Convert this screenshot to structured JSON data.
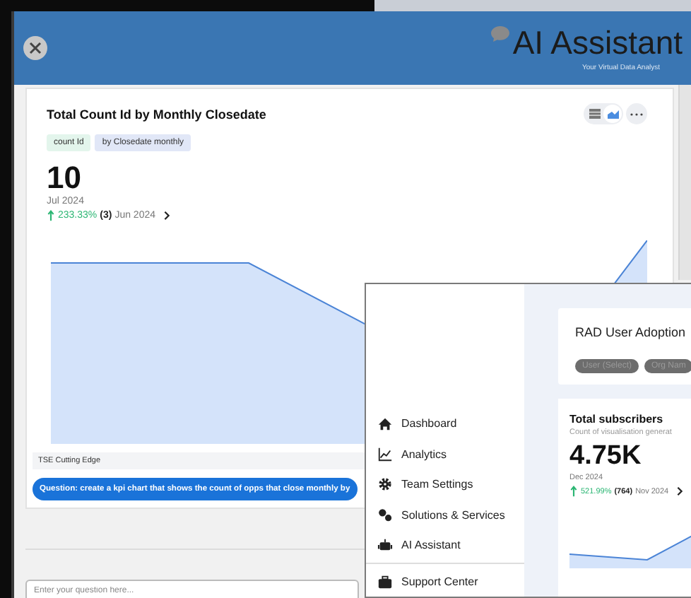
{
  "assistant_window": {
    "title": "AI Assistant",
    "subtitle": "Your Virtual Data Analyst",
    "card": {
      "title": "Total Count Id by Monthly Closedate",
      "view_toggle": [
        {
          "kind": "table",
          "selected": false
        },
        {
          "kind": "chart",
          "selected": true
        }
      ],
      "chips": [
        {
          "label": "count Id",
          "kind": "measure"
        },
        {
          "label": "by Closedate monthly",
          "kind": "dimension"
        }
      ],
      "value": "10",
      "period": "Jul 2024",
      "change": {
        "percent": "233.33%",
        "delta": "(3)",
        "previous": "Jun 2024"
      },
      "source": "TSE Cutting Edge",
      "question": "Question: create a kpi chart that shows the count of opps that close monthly by"
    },
    "input": {
      "placeholder": "Enter your question here..."
    }
  },
  "dashboard_window": {
    "nav": [
      {
        "label": "Dashboard",
        "kind": "home"
      },
      {
        "label": "Analytics",
        "kind": "chart"
      },
      {
        "label": "Team Settings",
        "kind": "gear"
      },
      {
        "label": "Solutions & Services",
        "kind": "gears"
      },
      {
        "label": "AI Assistant",
        "kind": "robot"
      },
      {
        "label": "Support Center",
        "kind": "briefcase"
      }
    ],
    "report": {
      "title": "RAD User Adoption",
      "filters": [
        "User (Select)",
        "Org Nam"
      ]
    },
    "kpi": {
      "title": "Total subscribers",
      "subtitle": "Count of visualisation generat",
      "value": "4.75K",
      "period": "Dec 2024",
      "change": {
        "percent": "521.99%",
        "delta": "(764)",
        "previous": "Nov 2024"
      }
    }
  }
}
